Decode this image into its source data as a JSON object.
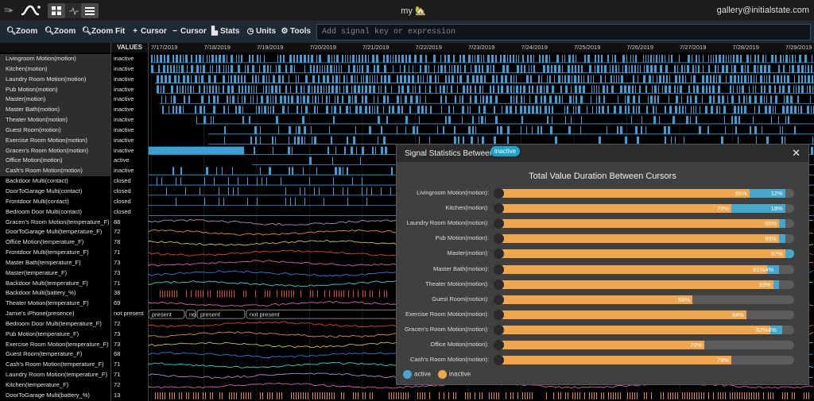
{
  "topbar": {
    "title": "my 🏡",
    "user": "gallery@initialstate.com",
    "menu_icon": "hamburger-menu-icon",
    "logo_icon": "wave-logo-icon"
  },
  "toolbar": {
    "zoom_in": "Zoom",
    "zoom_out": "Zoom",
    "zoom_fit": "Zoom Fit",
    "add_cursor": "Cursor",
    "remove_cursor": "Cursor",
    "stats": "Stats",
    "units": "Units",
    "tools": "Tools",
    "expression_placeholder": "Add signal key or expression"
  },
  "header": {
    "values_label": "VALUES"
  },
  "dates": [
    "7/17/2019",
    "7/18/2019",
    "7/19/2019",
    "7/20/2019",
    "7/21/2019",
    "7/22/2019",
    "7/23/2019",
    "7/24/2019",
    "7/25/2019",
    "7/26/2019",
    "7/27/2019",
    "7/28/2019",
    "7/29/2019"
  ],
  "signals": [
    {
      "name": "Livingroom Motion(motion)",
      "value": "inactive",
      "type": "motion"
    },
    {
      "name": "Kitchen(motion)",
      "value": "inactive",
      "type": "motion"
    },
    {
      "name": "Laundry Room Motion(motion)",
      "value": "inactive",
      "type": "motion"
    },
    {
      "name": "Pub Motion(motion)",
      "value": "inactive",
      "type": "motion"
    },
    {
      "name": "Master(motion)",
      "value": "inactive",
      "type": "motion"
    },
    {
      "name": "Master Bath(motion)",
      "value": "inactive",
      "type": "motion"
    },
    {
      "name": "Theater Motion(motion)",
      "value": "inactive",
      "type": "motion"
    },
    {
      "name": "Guest Room(motion)",
      "value": "inactive",
      "type": "motion"
    },
    {
      "name": "Exercise Room Motion(motion)",
      "value": "inactive",
      "type": "motion"
    },
    {
      "name": "Gracen's Room Motion(motion)",
      "value": "inactive",
      "type": "motion"
    },
    {
      "name": "Office Motion(motion)",
      "value": "active",
      "type": "motion"
    },
    {
      "name": "Cash's Room Motion(motion)",
      "value": "inactive",
      "type": "motion"
    },
    {
      "name": "Backdoor Multi(contact)",
      "value": "closed",
      "type": "contact"
    },
    {
      "name": "DoorToGarage Multi(contact)",
      "value": "closed",
      "type": "contact"
    },
    {
      "name": "Frontdoor Multi(contact)",
      "value": "closed",
      "type": "contact"
    },
    {
      "name": "Bedroom Door Multi(contact)",
      "value": "closed",
      "type": "contact"
    },
    {
      "name": "Gracen's Room Motion(temperature_F)",
      "value": "88",
      "type": "line",
      "color": "#b583d6"
    },
    {
      "name": "DoorToGarage Multi(temperature_F)",
      "value": "72",
      "type": "line",
      "color": "#e58b2a"
    },
    {
      "name": "Office Motion(temperature_F)",
      "value": "78",
      "type": "line",
      "color": "#c8c82a"
    },
    {
      "name": "Frontdoor Multi(temperature_F)",
      "value": "71",
      "type": "line",
      "color": "#e0403c"
    },
    {
      "name": "Master Bath(temperature_F)",
      "value": "73",
      "type": "line",
      "color": "#d65fb0"
    },
    {
      "name": "Master(temperature_F)",
      "value": "73",
      "type": "line",
      "color": "#2a7be0"
    },
    {
      "name": "Backdoor Multi(temperature_F)",
      "value": "71",
      "type": "line",
      "color": "#2ad6c8"
    },
    {
      "name": "Backdoor Multi(battery_%)",
      "value": "38",
      "type": "battery",
      "color": "#e0403c"
    },
    {
      "name": "Theater Motion(temperature_F)",
      "value": "69",
      "type": "line",
      "color": "#d65fb0"
    },
    {
      "name": "Jamie's iPhone(presence)",
      "value": "not present",
      "type": "presence"
    },
    {
      "name": "Bedroom Door Multi(temperature_F)",
      "value": "72",
      "type": "line",
      "color": "#e0403c"
    },
    {
      "name": "Pub Motion(temperature_F)",
      "value": "73",
      "type": "line",
      "color": "#e58b2a"
    },
    {
      "name": "Exercise Room Motion(temperature_F)",
      "value": "73",
      "type": "line",
      "color": "#c8c82a"
    },
    {
      "name": "Guest Room(temperature_F)",
      "value": "68",
      "type": "line",
      "color": "#2a7be0"
    },
    {
      "name": "Cash's Room Motion(temperature_F)",
      "value": "71",
      "type": "line",
      "color": "#2ad6c8"
    },
    {
      "name": "Laundry Room Motion(temperature_F)",
      "value": "71",
      "type": "line",
      "color": "#b583d6"
    },
    {
      "name": "Kitchen(temperature_F)",
      "value": "72",
      "type": "line",
      "color": "#d65fb0"
    },
    {
      "name": "DoorToGarage Multi(battery_%)",
      "value": "13",
      "type": "battery",
      "color": "#e58b2a"
    }
  ],
  "presence_labels": [
    "present",
    "no",
    "present",
    "not present"
  ],
  "stats_panel": {
    "title": "Signal Statistics Between",
    "tag": "inactive",
    "close_icon": "close-icon",
    "chart_title": "Total Value Duration Between Cursors",
    "legend": [
      {
        "label": "active",
        "color": "#46a7cc"
      },
      {
        "label": "inactive",
        "color": "#efa64d"
      }
    ]
  },
  "chart_data": {
    "type": "bar",
    "title": "Total Value Duration Between Cursors",
    "categories": [
      "Livingroom Motion(motion):",
      "Kitchen(motion):",
      "Laundry Room Motion(motion):",
      "Pub Motion(motion):",
      "Master(motion):",
      "Master Bath(motion):",
      "Theater Motion(motion):",
      "Guest Room(motion):",
      "Exercise Room Motion(motion):",
      "Gracen's Room Motion(motion):",
      "Office Motion(motion):",
      "Cash's Room Motion(motion):"
    ],
    "series": [
      {
        "name": "inactive",
        "values": [
          85,
          79,
          95,
          95,
          97,
          91,
          93,
          66,
          84,
          92,
          70,
          79
        ]
      },
      {
        "name": "active",
        "values": [
          12,
          18,
          2,
          2,
          3,
          4,
          2,
          0,
          0,
          4,
          0,
          0
        ]
      }
    ],
    "shown_active_labels": [
      12,
      18,
      null,
      null,
      null,
      4,
      null,
      null,
      null,
      4,
      null,
      null
    ],
    "ylim": [
      0,
      100
    ],
    "legend_position": "bottom-left"
  }
}
